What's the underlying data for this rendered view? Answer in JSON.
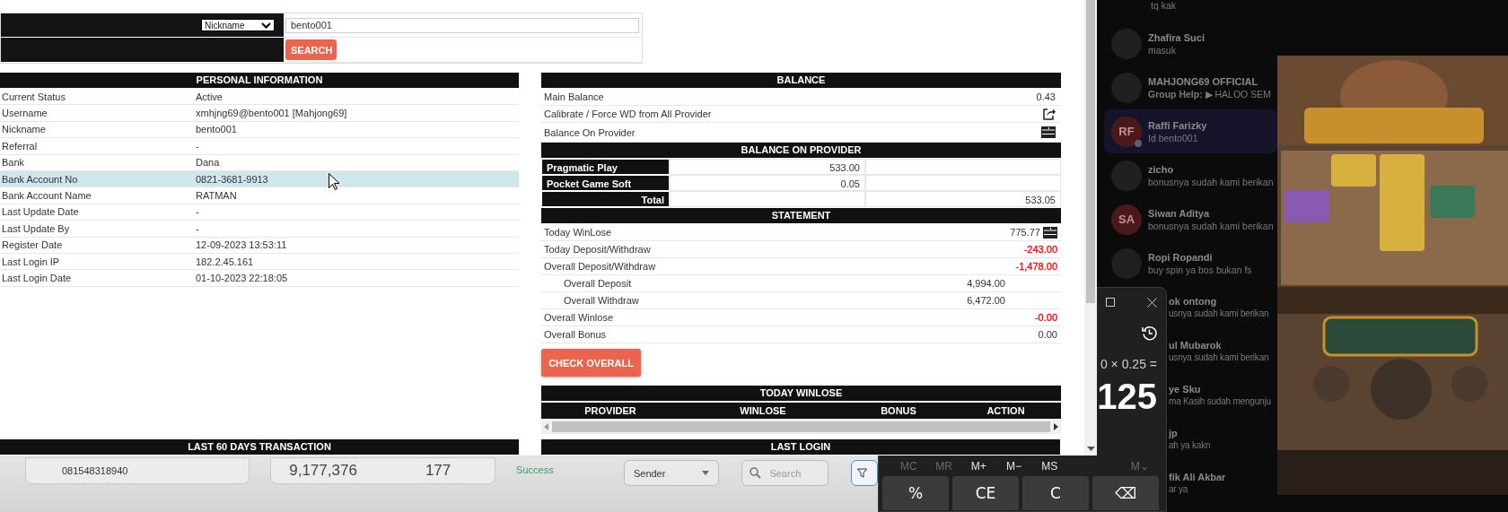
{
  "search_form": {
    "field_type": "Nickname",
    "query": "bento001",
    "button": "SEARCH"
  },
  "personal_information": {
    "title": "PERSONAL INFORMATION",
    "rows": [
      {
        "label": "Current Status",
        "value": "Active",
        "selected": false
      },
      {
        "label": "Username",
        "value": "xmhjng69@bento001  [Mahjong69]",
        "selected": false
      },
      {
        "label": "Nickname",
        "value": "bento001",
        "selected": false
      },
      {
        "label": "Referral",
        "value": "-",
        "selected": false
      },
      {
        "label": "Bank",
        "value": "Dana",
        "selected": false
      },
      {
        "label": "Bank Account No",
        "value": "0821-3681-9913",
        "selected": true
      },
      {
        "label": "Bank Account Name",
        "value": "RATMAN",
        "selected": false
      },
      {
        "label": "Last Update Date",
        "value": "-",
        "selected": false
      },
      {
        "label": "Last Update By",
        "value": "-",
        "selected": false
      },
      {
        "label": "Register Date",
        "value": "12-09-2023 13:53:11",
        "selected": false
      },
      {
        "label": "Last Login IP",
        "value": "182.2.45.161",
        "selected": false
      },
      {
        "label": "Last Login Date",
        "value": "01-10-2023 22:18:05",
        "selected": false
      }
    ]
  },
  "balance": {
    "title": "BALANCE",
    "rows": [
      {
        "kind": "value",
        "label": "Main Balance",
        "value": "0.43"
      },
      {
        "kind": "share",
        "label": "Calibrate / Force WD from All Provider"
      },
      {
        "kind": "list",
        "label": "Balance On Provider"
      }
    ]
  },
  "balance_on_provider": {
    "title": "BALANCE ON PROVIDER",
    "rows": [
      {
        "kind": "provider",
        "name": "Pragmatic Play",
        "amount": "533.00"
      },
      {
        "kind": "provider",
        "name": "Pocket Game Soft",
        "amount": "0.05"
      },
      {
        "kind": "total",
        "name": "Total",
        "amount": "533.05"
      }
    ]
  },
  "statement": {
    "title": "STATEMENT",
    "rows": [
      {
        "kind": "list",
        "label": "Today WinLose",
        "value": "775.77"
      },
      {
        "kind": "main",
        "label": "Today Deposit/Withdraw",
        "value": "-243.00",
        "color": "#ff0000"
      },
      {
        "kind": "main",
        "label": "Overall Deposit/Withdraw",
        "value": "-1,478.00",
        "color": "#ff0000"
      },
      {
        "kind": "sub",
        "label": "Overall Deposit",
        "value": "4,994.00"
      },
      {
        "kind": "sub",
        "label": "Overall Withdraw",
        "value": "6,472.00"
      },
      {
        "kind": "main",
        "label": "Overall Winlose",
        "value": "-0.00",
        "color": "#ff0000"
      },
      {
        "kind": "main",
        "label": "Overall Bonus",
        "value": "0.00"
      }
    ]
  },
  "check_button": "CHECK OVERALL",
  "today_winlose": {
    "title": "TODAY WINLOSE",
    "columns": [
      "PROVIDER",
      "WINLOSE",
      "BONUS",
      "ACTION"
    ]
  },
  "last_60_days": {
    "title": "LAST 60 DAYS TRANSACTION"
  },
  "last_login": {
    "title": "LAST LOGIN"
  },
  "background_page": {
    "phone": "081548318940",
    "amount": "9,177,376",
    "count": "177",
    "status": "Success",
    "sender_select": "Sender",
    "search_placeholder": "Search"
  },
  "chat_list": [
    {
      "kind": "preview-only",
      "preview": "tq kak",
      "selected": false
    },
    {
      "kind": "full",
      "name": "Zhafira Suci",
      "preview": "masuk",
      "selected": false,
      "online": false
    },
    {
      "kind": "full",
      "name": "MAHJONG69 OFFICIAL",
      "preview": "**Group Help:** ▶ HALOO SEM",
      "selected": false,
      "online": false
    },
    {
      "kind": "full",
      "initials": "RF",
      "name": "Raffi Farizky",
      "preview": "Id bento001",
      "selected": true,
      "online": true
    },
    {
      "kind": "full",
      "name": "zicho",
      "preview": "bonusnya sudah kami berikan",
      "selected": false,
      "online": false
    },
    {
      "kind": "full",
      "initials": "SA",
      "name": "Siwan Aditya",
      "preview": "bonusnya sudah kami berikan",
      "selected": false,
      "online": false
    },
    {
      "kind": "full",
      "name": "Ropi Ropandi",
      "preview": "buy spin ya bos bukan fs",
      "selected": false,
      "online": false
    },
    {
      "kind": "cut",
      "name": "ok ontong",
      "preview": "usnya sudah kami berikan",
      "selected": false
    },
    {
      "kind": "cut",
      "name": "ul Mubarok",
      "preview": "usnya sudah kami berikan",
      "selected": false
    },
    {
      "kind": "cut",
      "name": "ye Sku",
      "preview": "ma Kasih sudah mengunju",
      "selected": false
    },
    {
      "kind": "cut",
      "name": "jp",
      "preview": "ah ya kakn",
      "selected": false
    },
    {
      "kind": "cut",
      "name": "fik Ali Akbar",
      "preview": "ar ya",
      "selected": false
    }
  ],
  "calculator": {
    "expression": "0 × 0.25 =",
    "result": "125",
    "memory": [
      {
        "label": "MC",
        "disabled": true
      },
      {
        "label": "MR",
        "disabled": true
      },
      {
        "label": "M+",
        "disabled": false
      },
      {
        "label": "M−",
        "disabled": false
      },
      {
        "label": "MS",
        "disabled": false
      },
      {
        "label": "M⌄",
        "disabled": true
      }
    ],
    "keys": [
      "%",
      "CE",
      "C",
      "⌫"
    ]
  }
}
